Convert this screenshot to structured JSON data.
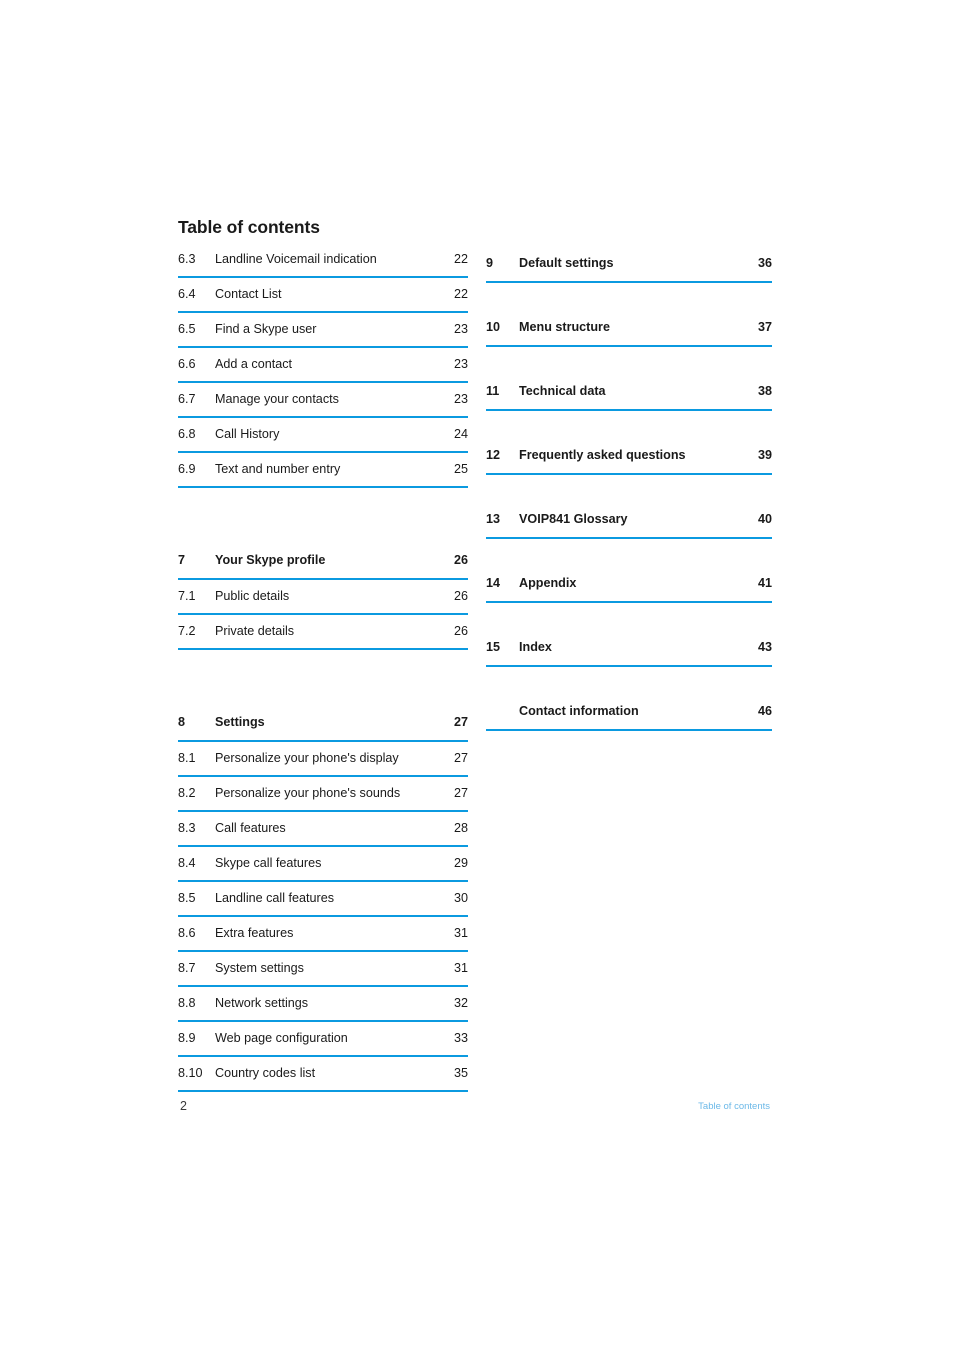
{
  "document": {
    "title": "Table of contents",
    "accent_color": "#0b9ae0",
    "footer_label_color": "#6cb9e8",
    "text_color": "#1a1a1a"
  },
  "footer": {
    "page_number": "2",
    "section_label": "Table of contents"
  },
  "columns": {
    "left": [
      {
        "num": "6.3",
        "label": "Landline Voicemail indication",
        "page": "22",
        "bold": false,
        "gap_above": false
      },
      {
        "num": "6.4",
        "label": "Contact List",
        "page": "22",
        "bold": false,
        "gap_above": false
      },
      {
        "num": "6.5",
        "label": "Find a Skype user",
        "page": "23",
        "bold": false,
        "gap_above": false
      },
      {
        "num": "6.6",
        "label": "Add a contact",
        "page": "23",
        "bold": false,
        "gap_above": false
      },
      {
        "num": "6.7",
        "label": "Manage your contacts",
        "page": "23",
        "bold": false,
        "gap_above": false
      },
      {
        "num": "6.8",
        "label": "Call History",
        "page": "24",
        "bold": false,
        "gap_above": false
      },
      {
        "num": "6.9",
        "label": "Text and number entry",
        "page": "25",
        "bold": false,
        "gap_above": false
      },
      {
        "num": "7",
        "label": "Your Skype profile",
        "page": "26",
        "bold": true,
        "gap_above": true
      },
      {
        "num": "7.1",
        "label": "Public details",
        "page": "26",
        "bold": false,
        "gap_above": false
      },
      {
        "num": "7.2",
        "label": "Private details",
        "page": "26",
        "bold": false,
        "gap_above": false
      },
      {
        "num": "8",
        "label": "Settings",
        "page": "27",
        "bold": true,
        "gap_above": true
      },
      {
        "num": "8.1",
        "label": "Personalize your phone's display",
        "page": "27",
        "bold": false,
        "gap_above": false
      },
      {
        "num": "8.2",
        "label": "Personalize your phone's sounds",
        "page": "27",
        "bold": false,
        "gap_above": false
      },
      {
        "num": "8.3",
        "label": "Call features",
        "page": "28",
        "bold": false,
        "gap_above": false
      },
      {
        "num": "8.4",
        "label": "Skype call features",
        "page": "29",
        "bold": false,
        "gap_above": false
      },
      {
        "num": "8.5",
        "label": "Landline call features",
        "page": "30",
        "bold": false,
        "gap_above": false
      },
      {
        "num": "8.6",
        "label": "Extra features",
        "page": "31",
        "bold": false,
        "gap_above": false
      },
      {
        "num": "8.7",
        "label": "System settings",
        "page": "31",
        "bold": false,
        "gap_above": false
      },
      {
        "num": "8.8",
        "label": "Network settings",
        "page": "32",
        "bold": false,
        "gap_above": false
      },
      {
        "num": "8.9",
        "label": "Web page configuration",
        "page": "33",
        "bold": false,
        "gap_above": false
      },
      {
        "num": "8.10",
        "label": "Country codes list",
        "page": "35",
        "bold": false,
        "gap_above": false
      }
    ],
    "right": [
      {
        "num": "9",
        "label": "Default settings",
        "page": "36",
        "bold": true
      },
      {
        "num": "10",
        "label": "Menu structure",
        "page": "37",
        "bold": true
      },
      {
        "num": "11",
        "label": "Technical data",
        "page": "38",
        "bold": true
      },
      {
        "num": "12",
        "label": "Frequently asked questions",
        "page": "39",
        "bold": true
      },
      {
        "num": "13",
        "label": "VOIP841 Glossary",
        "page": "40",
        "bold": true
      },
      {
        "num": "14",
        "label": "Appendix",
        "page": "41",
        "bold": true
      },
      {
        "num": "15",
        "label": "Index",
        "page": "43",
        "bold": true
      },
      {
        "num": "",
        "label": "Contact information",
        "page": "46",
        "bold": true
      }
    ]
  }
}
